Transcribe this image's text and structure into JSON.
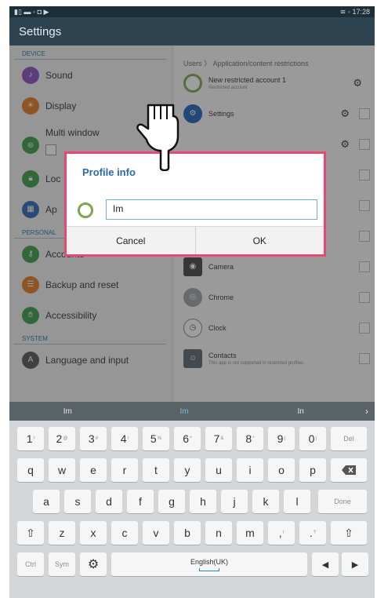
{
  "status": {
    "left": "▮▯ ▬ ◦ ◘ ▶",
    "right": "≋ ◦ 17:28"
  },
  "action_bar": {
    "title": "Settings"
  },
  "left": {
    "sections": {
      "device": "DEVICE",
      "personal": "PERSONAL",
      "system": "SYSTEM"
    },
    "items": {
      "sound": "Sound",
      "display": "Display",
      "multi_window": "Multi window",
      "lock": "Loc",
      "apps": "Ap",
      "accounts": "Accounts",
      "backup": "Backup and reset",
      "accessibility": "Accessibility",
      "language": "Language and input"
    }
  },
  "right": {
    "breadcrumb": "Users 〉 Application/content restrictions",
    "account_title": "New restricted account 1",
    "account_sub": "Restricted account",
    "settings": "Settings",
    "camera": "Camera",
    "chrome": "Chrome",
    "clock": "Clock",
    "contacts": "Contacts",
    "contacts_sub": "This app is not supported in restricted profiles"
  },
  "dialog": {
    "title": "Profile info",
    "input_value": "Im",
    "cancel": "Cancel",
    "ok": "OK"
  },
  "suggestions": {
    "left": "Im",
    "middle": "Im",
    "right": "In",
    "arrow": "›"
  },
  "keyboard": {
    "numbers": [
      "1",
      "2",
      "3",
      "4",
      "5",
      "6",
      "7",
      "8",
      "9",
      "0"
    ],
    "num_alt": [
      "!",
      "@",
      "#",
      "/",
      "%",
      "^",
      "&",
      "*",
      "(",
      ")"
    ],
    "del": "Del",
    "row1": [
      "q",
      "w",
      "e",
      "r",
      "t",
      "y",
      "u",
      "i",
      "o",
      "p"
    ],
    "row2": [
      "a",
      "s",
      "d",
      "f",
      "g",
      "h",
      "j",
      "k",
      "l"
    ],
    "done": "Done",
    "row3": [
      "z",
      "x",
      "c",
      "v",
      "b",
      "n",
      "m",
      ",",
      "."
    ],
    "row3_alt": [
      "",
      "",
      "",
      "",
      "",
      "",
      "",
      "!",
      "?"
    ],
    "ctrl": "Ctrl",
    "sym": "Sym",
    "language": "English(UK)",
    "left_arrow": "◀",
    "right_arrow": "▶"
  },
  "colors": {
    "action_bar": "#2d4350",
    "dialog_border": "#e84874",
    "dialog_title": "#2a6aa8",
    "accent_blue": "#1976a8"
  }
}
